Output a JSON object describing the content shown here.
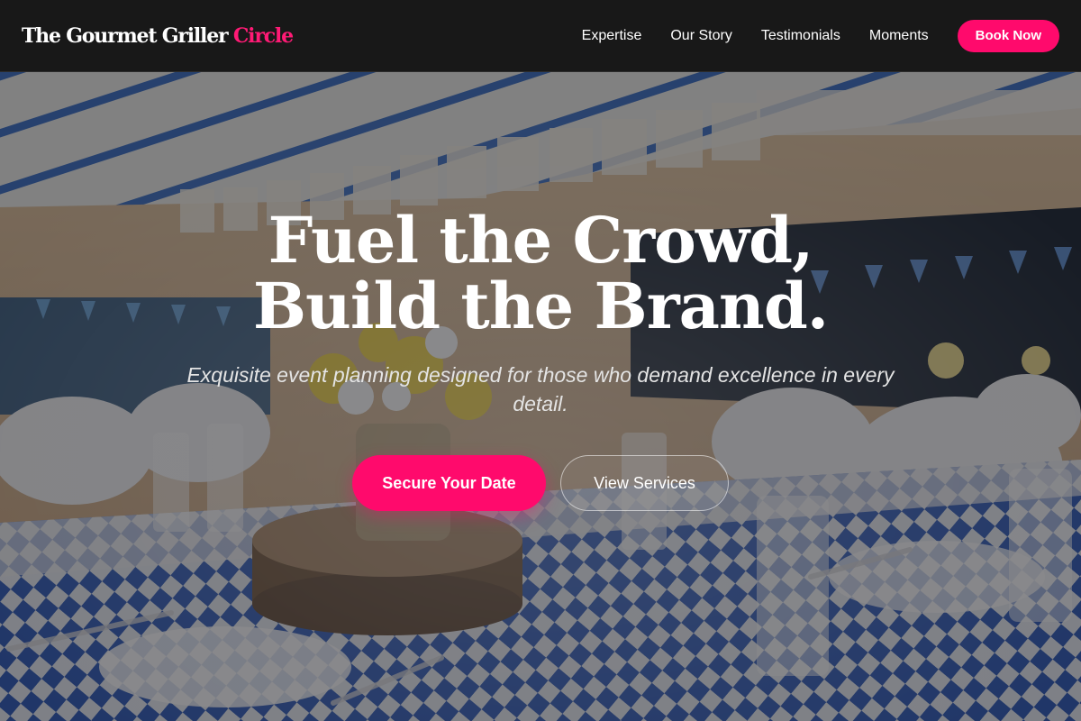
{
  "brand": {
    "name": "The Gourmet Griller",
    "accent": "Circle"
  },
  "nav": {
    "links": [
      "Expertise",
      "Our Story",
      "Testimonials",
      "Moments"
    ],
    "cta": "Book Now"
  },
  "hero": {
    "headline_line1": "Fuel the Crowd,",
    "headline_line2": "Build the Brand.",
    "subtitle": "Exquisite event planning designed for those who demand excellence in every detail.",
    "primary_cta": "Secure Your Date",
    "secondary_cta": "View Services",
    "background_image": "banquet-table-photo"
  },
  "colors": {
    "accent": "#ff0a6c",
    "nav_bg": "#181818",
    "text": "#ffffff"
  }
}
